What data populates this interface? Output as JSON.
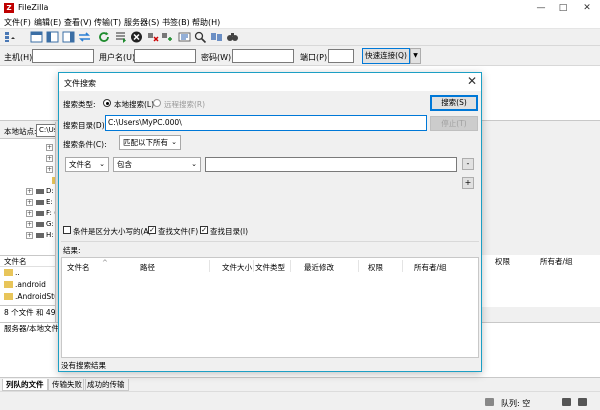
{
  "window": {
    "title": "FileZilla",
    "app_icon_glyph": "Z",
    "minimize": "—",
    "maximize": "□",
    "close": "✕"
  },
  "menu": [
    "文件(F)",
    "编辑(E)",
    "查看(V)",
    "传输(T)",
    "服务器(S)",
    "书签(B)",
    "帮助(H)"
  ],
  "quickconnect": {
    "host_label": "主机(H):",
    "user_label": "用户名(U):",
    "pass_label": "密码(W):",
    "port_label": "端口(P):",
    "button": "快速连接(Q)",
    "dropdown": "▼"
  },
  "local": {
    "site_label": "本地站点:",
    "site_value": "C:\\Use",
    "tree": [
      {
        "label": "D: (",
        "type": "drive"
      },
      {
        "label": "E: (",
        "type": "drive"
      },
      {
        "label": "F: (",
        "type": "drive"
      },
      {
        "label": "G: (",
        "type": "drive"
      },
      {
        "label": "H: (",
        "type": "drive"
      }
    ],
    "file_col": "文件名",
    "files": [
      "..",
      ".android",
      ".AndroidStudi"
    ],
    "status": "8 个文件 和 49 个"
  },
  "remote": {
    "col_perm": "权限",
    "col_owner": "所有者/组"
  },
  "queue": {
    "header": "服务器/本地文件",
    "tabs": [
      "列队的文件",
      "传输失败",
      "成功的传输"
    ],
    "status": "队列: 空"
  },
  "dialog": {
    "title": "文件搜索",
    "close": "✕",
    "search_type_label": "搜索类型:",
    "radio_local": "本地搜索(L)",
    "radio_remote": "远程搜索(R)",
    "search_button": "搜索(S)",
    "dir_label": "搜索目录(D):",
    "dir_value": "C:\\Users\\MyPC.000\\",
    "stop_button": "停止(T)",
    "cond_label": "搜索条件(C):",
    "cond_value": "匹配以下所有",
    "filter_field": "文件名",
    "filter_op": "包含",
    "filter_value": "",
    "minus": "-",
    "plus": "+",
    "check_case": "条件是区分大小写的(A)",
    "check_files": "查找文件(F)",
    "check_dirs": "查找目录(I)",
    "results_label": "结果:",
    "columns": [
      "文件名",
      "路径",
      "文件大小",
      "文件类型",
      "最近修改",
      "权限",
      "所有者/组"
    ],
    "status": "没有搜索结果"
  },
  "colors": {
    "accent": "#0078d7",
    "dialog_border": "#1c9fc4",
    "app_icon": "#bf0000",
    "folder": "#e8c55a"
  }
}
